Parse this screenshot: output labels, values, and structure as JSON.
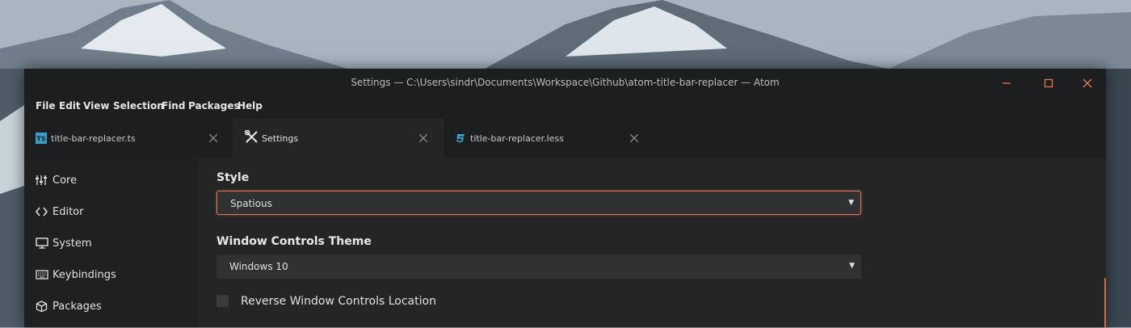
{
  "window": {
    "title": "Settings — C:\\Users\\sindr\\Documents\\Workspace\\Github\\atom-title-bar-replacer — Atom",
    "controls": [
      "minimize-icon",
      "maximize-icon",
      "close-icon"
    ],
    "accent_color": "#e07b56"
  },
  "menu": {
    "items": [
      "File",
      "Edit",
      "View",
      "Selection",
      "Find",
      "Packages",
      "Help"
    ]
  },
  "tabs": [
    {
      "label": "title-bar-replacer.ts",
      "icon": "typescript-file-icon",
      "active": false
    },
    {
      "label": "Settings",
      "icon": "tools-icon",
      "active": true
    },
    {
      "label": "title-bar-replacer.less",
      "icon": "css-file-icon",
      "active": false
    }
  ],
  "sidebar": {
    "items": [
      {
        "label": "Core",
        "icon": "sliders-icon"
      },
      {
        "label": "Editor",
        "icon": "code-icon"
      },
      {
        "label": "System",
        "icon": "monitor-icon"
      },
      {
        "label": "Keybindings",
        "icon": "keyboard-icon"
      },
      {
        "label": "Packages",
        "icon": "package-icon"
      }
    ]
  },
  "settings": {
    "style": {
      "title": "Style",
      "value": "Spatious"
    },
    "window_controls_theme": {
      "title": "Window Controls Theme",
      "value": "Windows 10"
    },
    "reverse_controls": {
      "label": "Reverse Window Controls Location",
      "checked": false
    }
  }
}
